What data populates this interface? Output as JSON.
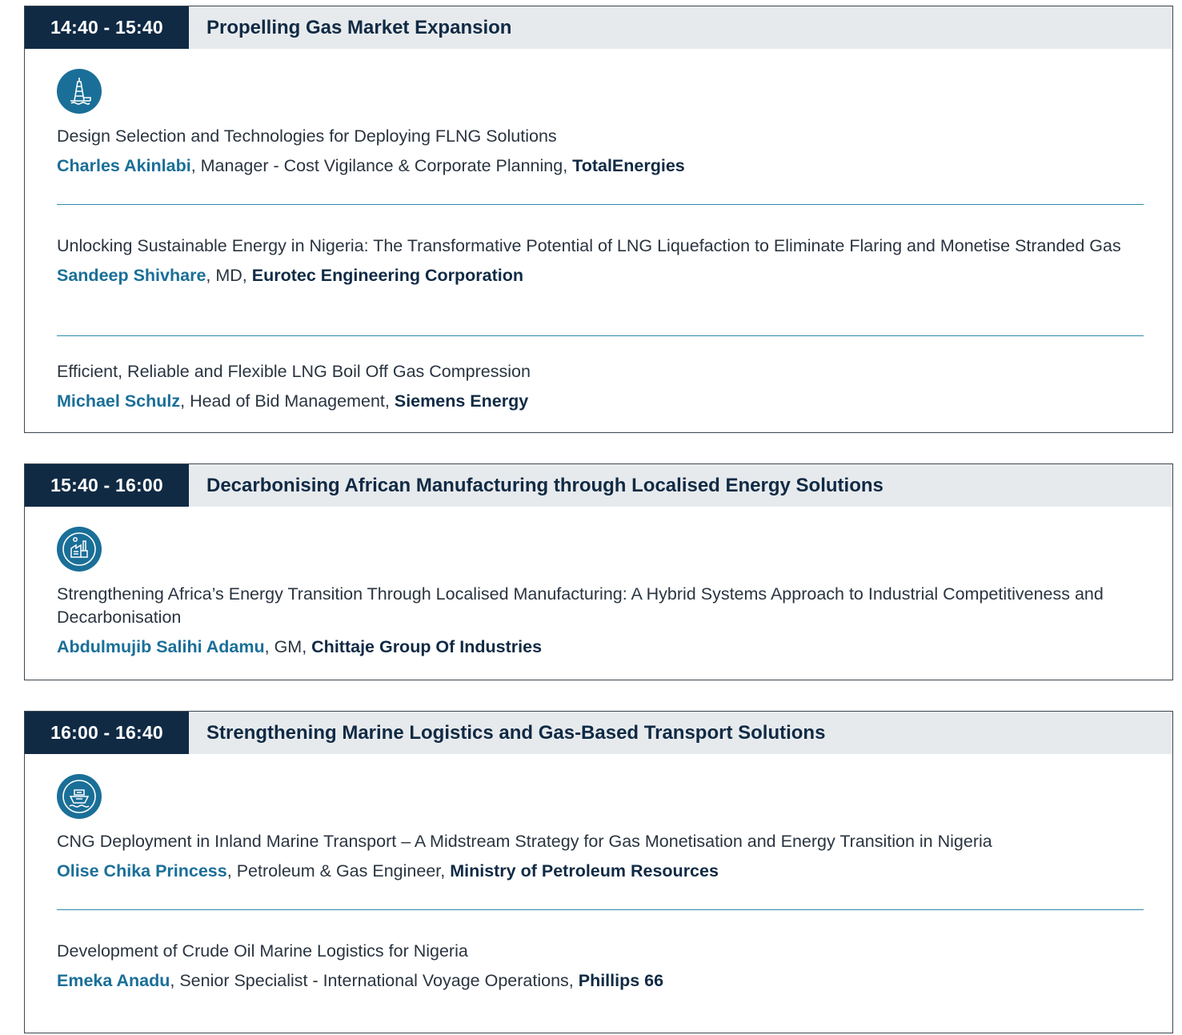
{
  "sessions": [
    {
      "time": "14:40 - 15:40",
      "title": "Propelling Gas Market Expansion",
      "icon": "gas-rig-icon",
      "talks": [
        {
          "title": "Design Selection and Technologies for Deploying FLNG Solutions",
          "speaker": "Charles Akinlabi",
          "role": "Manager - Cost Vigilance & Corporate Planning",
          "org": "TotalEnergies"
        },
        {
          "title": "Unlocking Sustainable Energy in Nigeria: The Transformative Potential of LNG Liquefaction to Eliminate Flaring and Monetise Stranded Gas",
          "speaker": "Sandeep Shivhare",
          "role": "MD",
          "org": "Eurotec Engineering Corporation"
        },
        {
          "title": "Efficient, Reliable and Flexible LNG Boil Off Gas Compression",
          "speaker": "Michael Schulz",
          "role": "Head of Bid Management",
          "org": "Siemens Energy"
        }
      ]
    },
    {
      "time": "15:40 - 16:00",
      "title": "Decarbonising African Manufacturing through Localised Energy Solutions",
      "icon": "factory-icon",
      "talks": [
        {
          "title": "Strengthening Africa’s Energy Transition Through Localised Manufacturing: A Hybrid Systems Approach to Industrial Competitiveness and Decarbonisation",
          "speaker": "Abdulmujib Salihi Adamu",
          "role": "GM",
          "org": "Chittaje Group Of Industries"
        }
      ]
    },
    {
      "time": "16:00 - 16:40",
      "title": "Strengthening Marine Logistics and Gas-Based Transport Solutions",
      "icon": "ship-icon",
      "talks": [
        {
          "title": "CNG Deployment in Inland Marine Transport – A Midstream Strategy for Gas Monetisation and Energy Transition in Nigeria",
          "speaker": "Olise Chika Princess",
          "role": "Petroleum & Gas Engineer",
          "org": "Ministry of Petroleum Resources"
        },
        {
          "title": "Development of Crude Oil Marine Logistics for Nigeria",
          "speaker": "Emeka Anadu",
          "role": "Senior Specialist - International Voyage Operations",
          "org": "Phillips 66"
        }
      ]
    }
  ],
  "colors": {
    "time_bg": "#102a44",
    "header_bg": "#e7eaed",
    "speaker_name": "#1a6f98",
    "divider": "#2d8bab",
    "icon_bg": "#1a6f98"
  }
}
